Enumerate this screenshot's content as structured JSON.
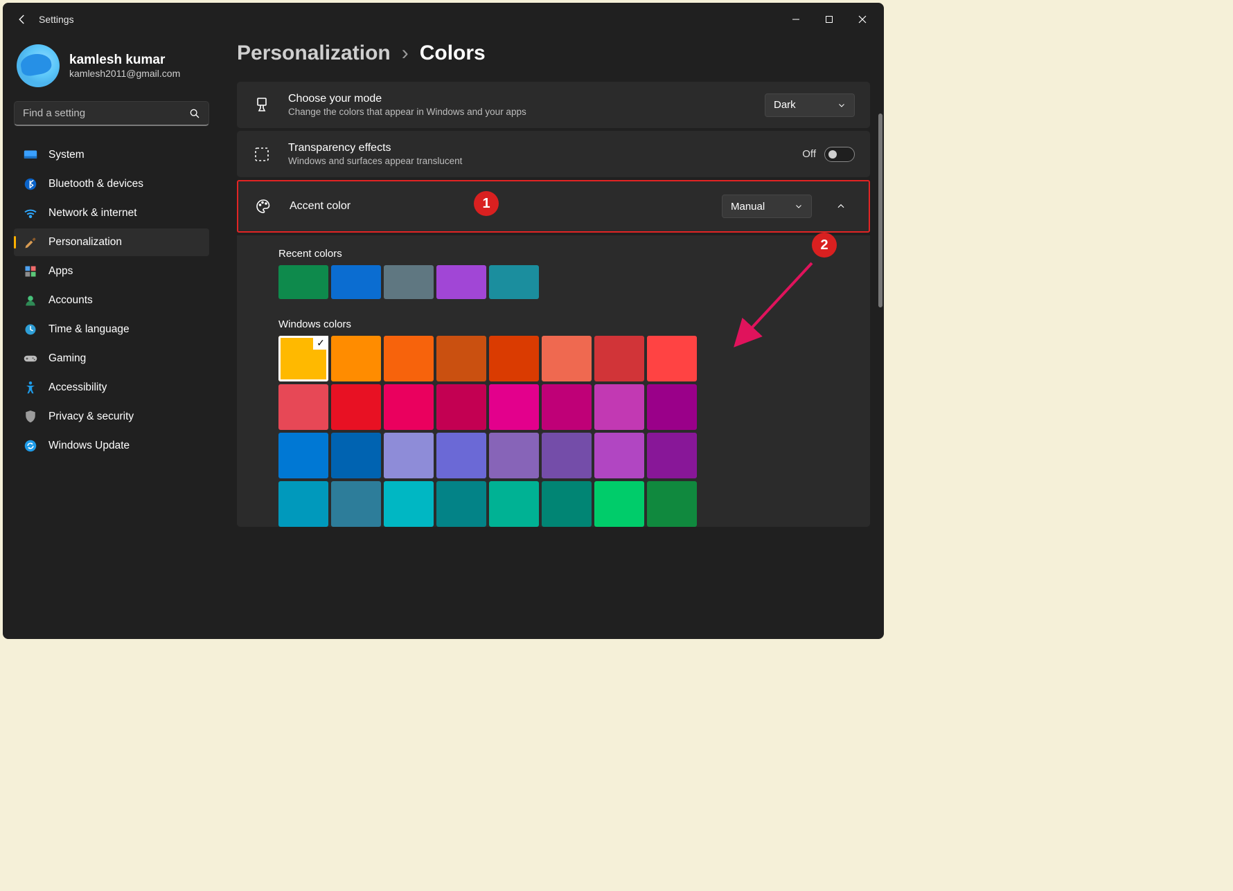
{
  "app_title": "Settings",
  "user": {
    "name": "kamlesh kumar",
    "email": "kamlesh2011@gmail.com"
  },
  "search": {
    "placeholder": "Find a setting"
  },
  "nav": [
    {
      "label": "System",
      "icon": "system-icon"
    },
    {
      "label": "Bluetooth & devices",
      "icon": "bluetooth-icon"
    },
    {
      "label": "Network & internet",
      "icon": "wifi-icon"
    },
    {
      "label": "Personalization",
      "icon": "brush-icon",
      "active": true
    },
    {
      "label": "Apps",
      "icon": "apps-icon"
    },
    {
      "label": "Accounts",
      "icon": "person-icon"
    },
    {
      "label": "Time & language",
      "icon": "clock-icon"
    },
    {
      "label": "Gaming",
      "icon": "gamepad-icon"
    },
    {
      "label": "Accessibility",
      "icon": "accessibility-icon"
    },
    {
      "label": "Privacy & security",
      "icon": "shield-icon"
    },
    {
      "label": "Windows Update",
      "icon": "update-icon"
    }
  ],
  "breadcrumb": {
    "parent": "Personalization",
    "current": "Colors"
  },
  "mode_card": {
    "title": "Choose your mode",
    "subtitle": "Change the colors that appear in Windows and your apps",
    "value": "Dark"
  },
  "transparency_card": {
    "title": "Transparency effects",
    "subtitle": "Windows and surfaces appear translucent",
    "toggle_label": "Off",
    "toggle_state": "off"
  },
  "accent_card": {
    "title": "Accent color",
    "value": "Manual"
  },
  "recent_colors": {
    "title": "Recent colors",
    "items": [
      "#0e8a4c",
      "#0b6dd1",
      "#5f7781",
      "#a146d6",
      "#1b8e9e"
    ]
  },
  "windows_colors": {
    "title": "Windows colors",
    "selected_index": 0,
    "rows": [
      [
        "#ffb900",
        "#ff8c00",
        "#f7630c",
        "#ca5010",
        "#da3b01",
        "#ef6950",
        "#d13438",
        "#ff4343"
      ],
      [
        "#e74856",
        "#e81123",
        "#ea005e",
        "#c30052",
        "#e3008c",
        "#bf0077",
        "#c239b3",
        "#9a0089"
      ],
      [
        "#0078d4",
        "#0063b1",
        "#8e8cd8",
        "#6b69d6",
        "#8764b8",
        "#744da9",
        "#b146c2",
        "#881798"
      ],
      [
        "#0099bc",
        "#2d7d9a",
        "#00b7c3",
        "#038387",
        "#00b294",
        "#018574",
        "#00cc6a",
        "#10893e"
      ]
    ]
  },
  "annotations": {
    "one": "1",
    "two": "2"
  }
}
